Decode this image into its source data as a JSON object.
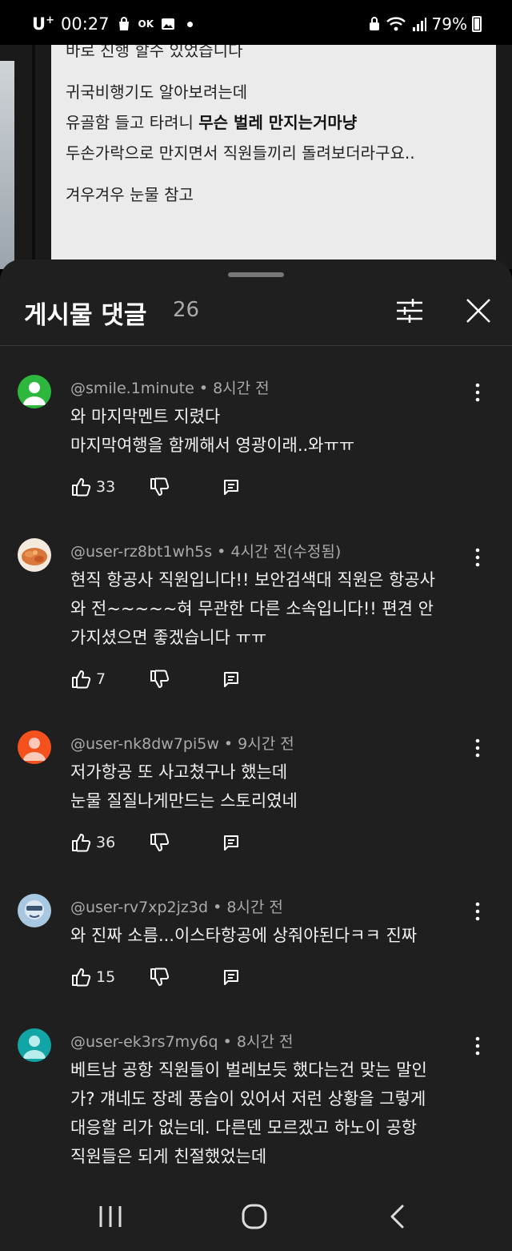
{
  "status_bar": {
    "carrier": "U",
    "carrier_sup": "+",
    "time": "00:27",
    "ok_badge": "OK",
    "battery": "79%"
  },
  "background_post": {
    "lines": [
      "바로 진행 할수 있었습니다",
      "귀국비행기도 알아보려는데",
      "유골함 들고 타려니 ",
      "두손가락으로 만지면서 직원들끼리 돌려보더라구요..",
      "겨우겨우 눈물 참고"
    ],
    "bold_fragment": "무슨 벌레 만지는거마냥"
  },
  "sheet": {
    "title": "게시물 댓글",
    "count": "26",
    "filter_icon": "sliders-icon",
    "close_icon": "close-icon"
  },
  "comments": [
    {
      "author": "@smile.1minute",
      "time": "8시간 전",
      "lines": [
        "와 마지막멘트 지렸다",
        "마지막여행을 함께해서 영광이래..와ㅠㅠ"
      ],
      "likes": "33",
      "avatar_color": "#2db83d"
    },
    {
      "author": "@user-rz8bt1wh5s",
      "time": "4시간 전(수정됨)",
      "lines": [
        "현직 항공사 직원입니다!! 보안검색대 직원은 항공사",
        "와 전~~~~~혀 무관한 다른 소속입니다!! 편견 안",
        "가지셨으면 좋겠습니다 ㅠㅠ"
      ],
      "likes": "7",
      "avatar_color": "#d9a26a"
    },
    {
      "author": "@user-nk8dw7pi5w",
      "time": "9시간 전",
      "lines": [
        "저가항공 또 사고쳤구나 했는데",
        "눈물 질질나게만드는 스토리였네"
      ],
      "likes": "36",
      "avatar_color": "#f4511e"
    },
    {
      "author": "@user-rv7xp2jz3d",
      "time": "8시간 전",
      "lines": [
        "와 진짜 소름...이스타항공에 상줘야된다ㅋㅋ 진짜"
      ],
      "likes": "15",
      "avatar_color": "#a8c7e0"
    },
    {
      "author": "@user-ek3rs7my6q",
      "time": "8시간 전",
      "lines": [
        "베트남 공항 직원들이 벌레보듯 했다는건 맞는 말인",
        "가? 걔네도 장례 풍습이 있어서 저런 상황을 그렇게",
        "대응할 리가 없는데. 다른덴 모르겠고 하노이 공항",
        "직원들은 되게 친절했었는데"
      ],
      "likes": "",
      "avatar_color": "#12a5a5"
    }
  ],
  "nav_bar": {
    "recents_icon": "recents-icon",
    "home_icon": "home-icon",
    "back_icon": "back-icon"
  },
  "colors": {
    "sheet_bg": "#1f1f1f",
    "text_primary": "#f1f1f1",
    "text_secondary": "#aaaaaa"
  }
}
